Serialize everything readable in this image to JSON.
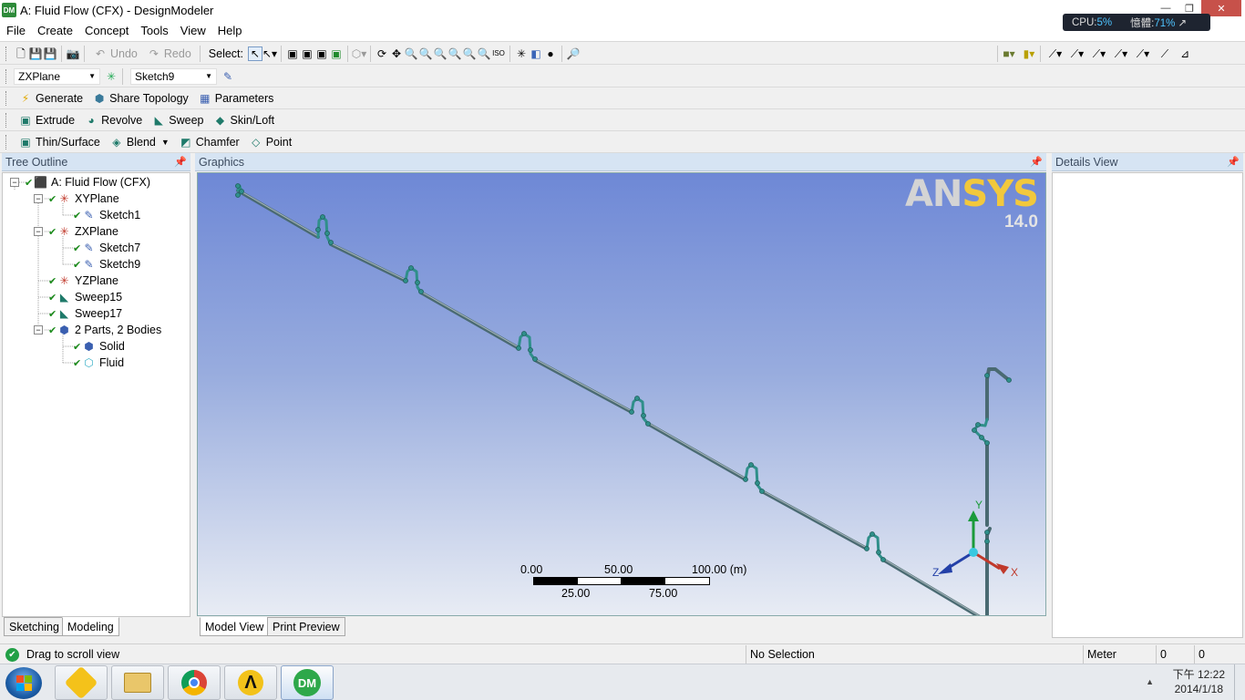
{
  "window": {
    "title": "A: Fluid Flow (CFX) - DesignModeler",
    "minimize": "—",
    "maximize": "❐",
    "close": "✕"
  },
  "cpu_widget": {
    "cpu_label": "CPU:",
    "cpu_value": "5%",
    "mem_label": "憶體:",
    "mem_value": "71%"
  },
  "menu": [
    "File",
    "Create",
    "Concept",
    "Tools",
    "View",
    "Help"
  ],
  "toolbar1": {
    "undo": "Undo",
    "redo": "Redo",
    "select_label": "Select:"
  },
  "toolbar2": {
    "plane": "ZXPlane",
    "sketch": "Sketch9"
  },
  "toolbar3": {
    "generate": "Generate",
    "share_topology": "Share Topology",
    "parameters": "Parameters"
  },
  "toolbar4": {
    "extrude": "Extrude",
    "revolve": "Revolve",
    "sweep": "Sweep",
    "skin_loft": "Skin/Loft"
  },
  "toolbar5": {
    "thin_surface": "Thin/Surface",
    "blend": "Blend",
    "chamfer": "Chamfer",
    "point": "Point"
  },
  "tree": {
    "header": "Tree Outline",
    "nodes": [
      {
        "label": "A: Fluid Flow (CFX)",
        "icon": "model-icon"
      },
      {
        "label": "XYPlane",
        "icon": "plane-icon"
      },
      {
        "label": "Sketch1",
        "icon": "sketch-icon"
      },
      {
        "label": "ZXPlane",
        "icon": "plane-icon"
      },
      {
        "label": "Sketch7",
        "icon": "sketch-icon"
      },
      {
        "label": "Sketch9",
        "icon": "sketch-icon"
      },
      {
        "label": "YZPlane",
        "icon": "plane-icon"
      },
      {
        "label": "Sweep15",
        "icon": "sweep-icon"
      },
      {
        "label": "Sweep17",
        "icon": "sweep-icon"
      },
      {
        "label": "2 Parts, 2 Bodies",
        "icon": "parts-icon"
      },
      {
        "label": "Solid",
        "icon": "solid-body-icon"
      },
      {
        "label": "Fluid",
        "icon": "fluid-body-icon"
      }
    ],
    "tabs": [
      "Sketching",
      "Modeling"
    ]
  },
  "graphics": {
    "header": "Graphics",
    "logo_brand_a": "AN",
    "logo_brand_b": "SYS",
    "logo_version": "14.0",
    "scale_top": [
      "0.00",
      "50.00",
      "100.00 (m)"
    ],
    "scale_bottom": [
      "25.00",
      "75.00"
    ],
    "axis_labels": {
      "x": "X",
      "y": "Y",
      "z": "Z"
    },
    "tabs": [
      "Model View",
      "Print Preview"
    ]
  },
  "details": {
    "header": "Details View"
  },
  "status": {
    "message": "Drag to scroll view",
    "selection": "No Selection",
    "units": "Meter",
    "val1": "0",
    "val2": "0"
  },
  "taskbar": {
    "clock_time": "下午 12:22",
    "clock_date": "2014/1/18"
  },
  "colors": {
    "accent_panel": "#d6e4f3",
    "pipe": "#2f8f8a",
    "close_button": "#c7514a"
  }
}
